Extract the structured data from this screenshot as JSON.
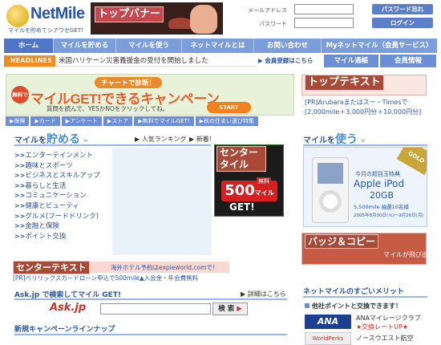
{
  "header": {
    "logo_text": "NetMile",
    "logo_sub": "マイルを貯めてシアワセGET!",
    "banner_label": "トップバナー",
    "login": {
      "mail_label": "メールアドレス",
      "pass_label": "パスワード",
      "forgot_btn": "パスワード忘れ",
      "login_btn": "ログイン"
    }
  },
  "nav": {
    "items": [
      "ホーム",
      "マイルを貯める",
      "マイルを使う",
      "ネットマイルとは",
      "お問い合わせ",
      "Myネットマイル（会員サービス）"
    ]
  },
  "headlines": {
    "tag": "HEADLINES",
    "text": "米国ハリケーン災害義援金の受付を開始しました",
    "register": "会員登録はこちら",
    "statement_btn": "マイル通帳",
    "info_btn": "会員情報"
  },
  "campaign": {
    "top": "チャートで診断！",
    "badge": "無料で",
    "main": "マイルGET!できるキャンペーン",
    "sub": "質問を読んで、YESかNOをクリックしてね。",
    "start": "START"
  },
  "tabs": [
    "▶保険",
    "▶カード",
    "▶アンケート",
    "▶ストア",
    "▶無料でマイルGET!",
    "▶秋の住まい選び特集"
  ],
  "top_text": {
    "label": "トップテキスト",
    "line1": "[PR]Arubaraまたはスー・Timesで",
    "line2": "[2,000mile＋3,000円分＋10,000円分]"
  },
  "earn": {
    "heading_pre": "マイルを",
    "heading_big": "貯める",
    "ranking": "人気ランキング",
    "new": "新着!",
    "categories": [
      "エンターテインメント",
      "趣味とスポーツ",
      "ビジネスとスキルアップ",
      "暮らしと生活",
      "コミュニケーション",
      "健康とビューティ",
      "グルメ(フードドリンク)",
      "金融と保険",
      "ポイント交換"
    ],
    "prefix": ">>"
  },
  "center_tile": {
    "label": "センタータイル",
    "amount": "500",
    "unit": "マイル",
    "free": "無料",
    "get": "GET!"
  },
  "use": {
    "heading_pre": "マイルを",
    "heading_big": "使う",
    "gold": "GOLD",
    "ad_title": "今月の超目玉特典",
    "ad_product": "Apple iPod",
    "ad_size": "20GB",
    "ad_detail": "5,500mile 抽選10名様",
    "ad_period": "2005年8月30日(火)〜9月26日(月)"
  },
  "center_text": {
    "label": "センターテキスト",
    "line1": "海外ホテル予約はexpleworld.comで！",
    "line2": "[PR]ベリリックスカードローン申込で500mile▲入会金・年会費無料"
  },
  "badge_copy": {
    "label": "バッジ＆コピー",
    "text": "マイルが飛び出す!"
  },
  "ask": {
    "heading": "Ask.jp で検索してマイル GET!",
    "details": "詳細はこちら",
    "logo": "Ask.jp",
    "search_btn": "検 索"
  },
  "new_campaign": {
    "heading": "新規キャンペーンラインナップ"
  },
  "merit": {
    "heading": "ネットマイルのすごいメリット",
    "subheading": "他社ポイントと交換できます！",
    "items": [
      {
        "logo": "ANA",
        "line1": "ANAマイレージクラブ",
        "line2": "★交換レートUP★"
      },
      {
        "logo": "WorldPerks",
        "line1": "ノースウエスト航空",
        "line2": ""
      }
    ]
  },
  "colors": {
    "brand_blue": "#2a57a8",
    "nav_blue": "#7b9edb",
    "headline_orange": "#f08b1c",
    "overlay_red": "#a84a35"
  }
}
